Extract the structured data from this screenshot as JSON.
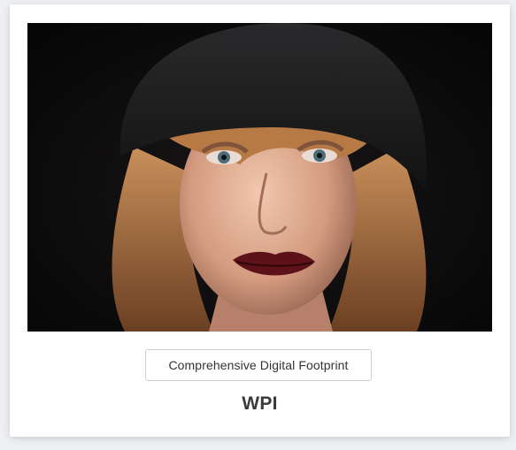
{
  "card": {
    "tag_label": "Comprehensive Digital Footprint",
    "caption": "WPI"
  },
  "photo": {
    "subject": "portrait-photo"
  },
  "colors": {
    "page_background": "#eef0f3",
    "card_background": "#ffffff",
    "button_border": "#cfcfcf",
    "text": "#3a3a3a"
  }
}
